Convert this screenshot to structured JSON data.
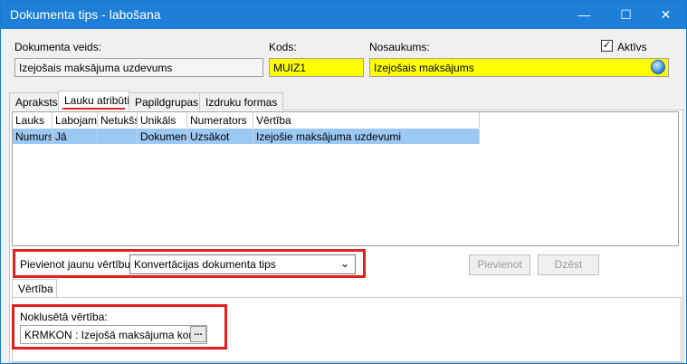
{
  "window": {
    "title": "Dokumenta tips - labošana",
    "minimize": "—",
    "maximize": "☐",
    "close": "✕"
  },
  "header": {
    "doc_type_label": "Dokumenta veids:",
    "doc_type_value": "Izejošais maksājuma uzdevums",
    "code_label": "Kods:",
    "code_value": "MUIZ1",
    "name_label": "Nosaukums:",
    "name_value": "Izejošais maksājums",
    "active_label": "Aktīvs",
    "active_checked": "✓"
  },
  "tabs": [
    "Apraksts",
    "Lauku atribūti",
    "Papildgrupas",
    "Izdruku formas"
  ],
  "grid": {
    "columns": [
      "Lauks",
      "Labojams",
      "Netukšs",
      "Unikāls",
      "Numerators",
      "Vērtība"
    ],
    "rows": [
      [
        "Numurs",
        "Jā",
        "",
        "Dokument",
        "Uzsākot",
        "Izejošie maksājuma uzdevumi"
      ]
    ]
  },
  "add_value": {
    "label": "Pievienot jaunu vērtību:",
    "selected": "Konvertācijas dokumenta tips",
    "add_button": "Pievienot",
    "delete_button": "Dzēst"
  },
  "value_tab": "Vērtība",
  "default_value": {
    "label": "Noklusētā vērtība:",
    "value": "KRMKON : Izejošā maksājuma konvert",
    "browse": "..."
  }
}
